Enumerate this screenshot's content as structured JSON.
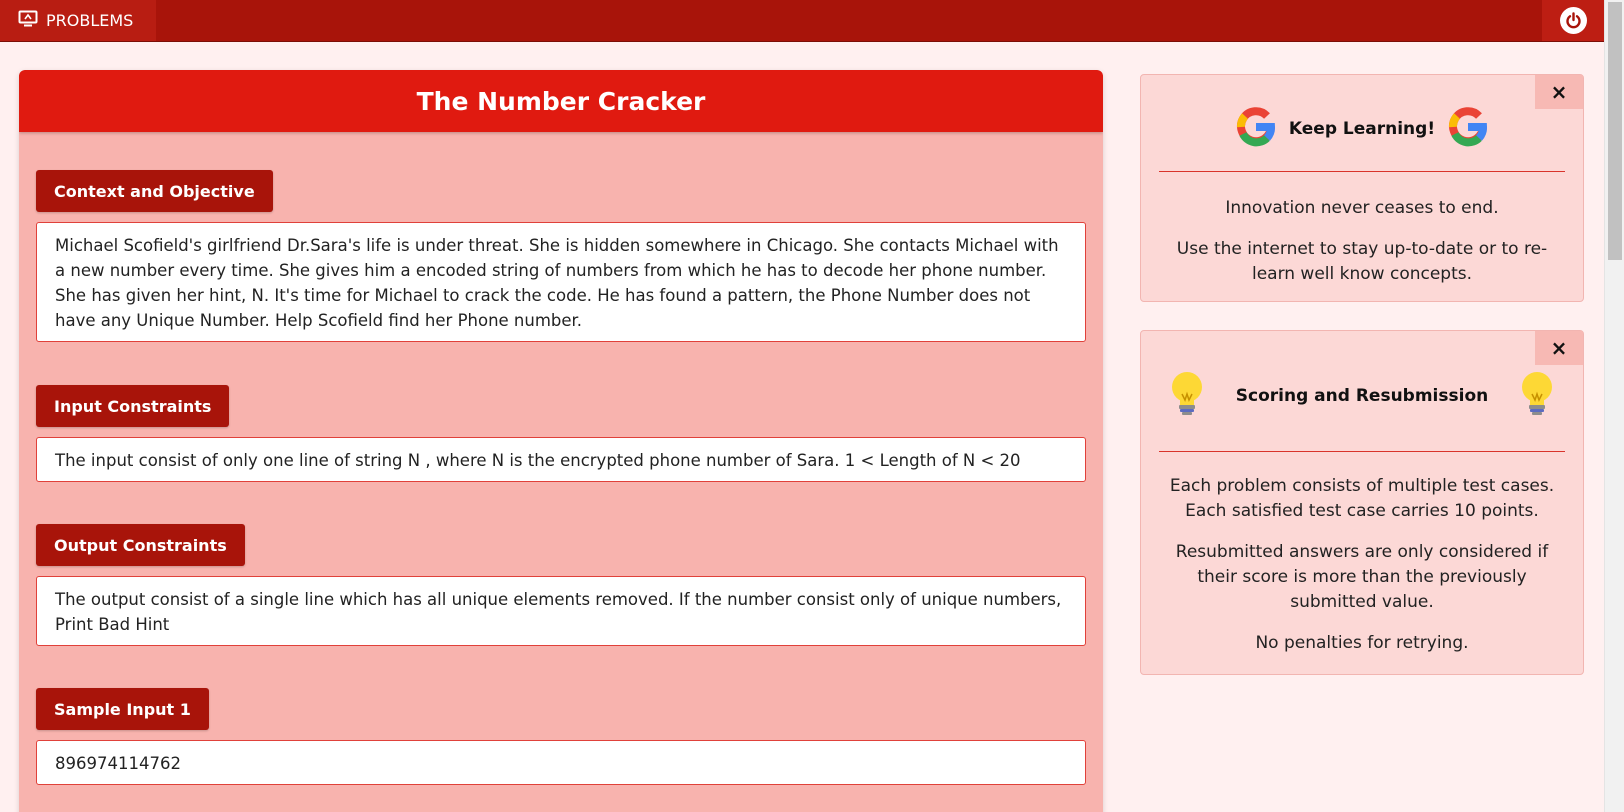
{
  "nav": {
    "problems_label": "PROBLEMS",
    "problems_icon": "monitor-icon",
    "power_icon": "power-icon"
  },
  "problem": {
    "title": "The Number Cracker",
    "sections": [
      {
        "label": "Context and Objective",
        "text": "Michael Scofield's girlfriend Dr.Sara's life is under threat. She is hidden somewhere in Chicago. She contacts Michael with a new number every time. She gives him a encoded string of numbers from which he has to decode her phone number. She has given her hint, N. It's time for Michael to crack the code. He has found a pattern, the Phone Number does not have any Unique Number. Help Scofield find her Phone number."
      },
      {
        "label": "Input Constraints",
        "text": "The input consist of only one line of string N , where N is the encrypted phone number of Sara. 1 < Length of N < 20"
      },
      {
        "label": "Output Constraints",
        "text": "The output consist of a single line which has all unique elements removed. If the number consist only of unique numbers, Print Bad Hint"
      },
      {
        "label": "Sample Input 1",
        "text": "896974114762"
      }
    ]
  },
  "side_cards": [
    {
      "title": "Keep Learning!",
      "icon": "google-logo-icon",
      "close_label": "×",
      "paragraphs": [
        "Innovation never ceases to end.",
        "Use the internet to stay up-to-date or to re-learn well know concepts."
      ]
    },
    {
      "title": "Scoring and Resubmission",
      "icon": "lightbulb-icon",
      "close_label": "×",
      "paragraphs": [
        "Each problem consists of multiple test cases. Each satisfied test case carries 10 points.",
        "Resubmitted answers are only considered if their score is more than the previously submitted value.",
        "No penalties for retrying."
      ]
    }
  ],
  "colors": {
    "nav_bg": "#a8140a",
    "header_red": "#e01a10",
    "label_red": "#a8140a",
    "card_pink": "#f8b3ae",
    "side_pink": "#fcd8d6"
  }
}
